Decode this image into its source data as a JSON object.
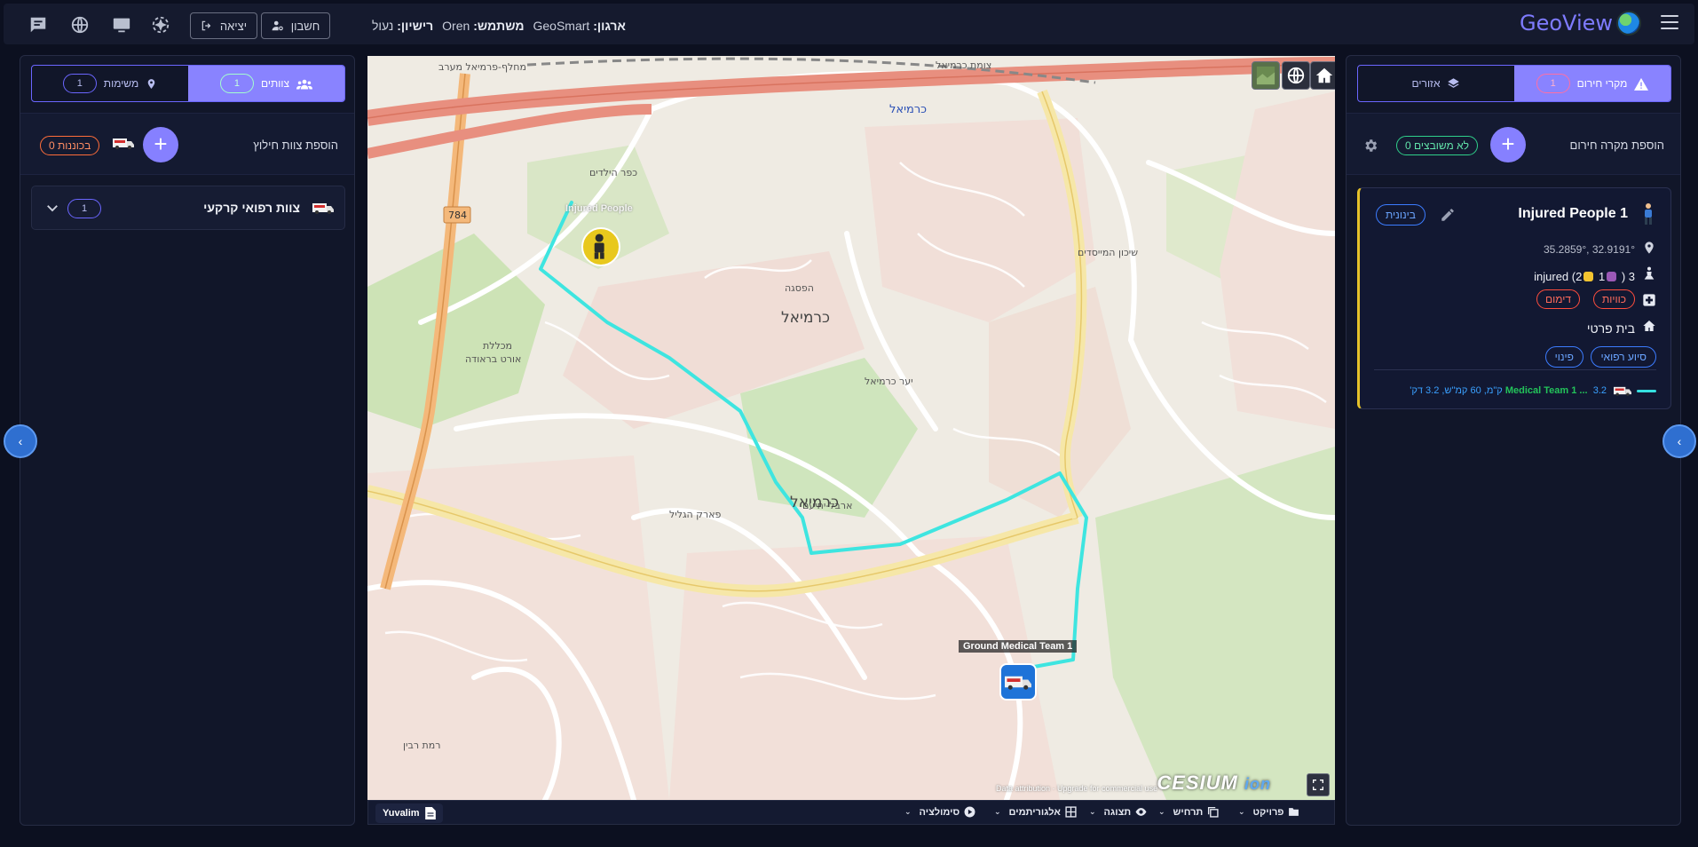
{
  "topbar": {
    "brand": "GeoView",
    "org_label": "ארגון:",
    "org_value": "GeoSmart",
    "user_label": "משתמש:",
    "user_value": "Oren",
    "license_label": "רישיון:",
    "license_value": "נעול",
    "account_button": "חשבון",
    "logout_button": "יציאה"
  },
  "left_panel": {
    "tab_teams": {
      "label": "צוותים",
      "count": "1"
    },
    "tab_missions": {
      "label": "משימות",
      "count": "1"
    },
    "add_team_label": "הוספת צוות חילוץ",
    "ready_pill": "0 בכוננות",
    "group": {
      "label": "צוות רפואי קרקעי",
      "count": "1"
    }
  },
  "right_panel": {
    "tab_incidents": {
      "label": "מקרי חירום",
      "count": "1"
    },
    "tab_areas": {
      "label": "אזורים"
    },
    "add_incident_label": "הוספת מקרה חירום",
    "unassigned_pill": "0 לא משובצים",
    "incident": {
      "title": "Injured People 1",
      "priority": "בינונית",
      "coords": "35.2859°, 32.9191°",
      "injured_total": "3",
      "injured_a": "1",
      "injured_b": "2",
      "injured_word": "injured",
      "tag_burns": "כוויות",
      "tag_bleeding": "דימום",
      "location": "בית פרטי",
      "need_medical": "סיוע רפואי",
      "need_evac": "פינוי",
      "route_team": "Medical Team 1 ...",
      "route_info": "3.2 ק\"מ, 60 קמ\"ש, 3.2 דק'"
    }
  },
  "map": {
    "person_label": "Injured People",
    "team_label": "Ground Medical Team 1",
    "credit": "Data attribution · Upgrade for commercial use",
    "cesium": "CESIUM",
    "cesium_ion": "ion",
    "city_names": [
      "כרמיאל",
      "כרמיאל",
      "כרמיאל"
    ]
  },
  "bottom_bar": {
    "project": "פרויקט",
    "scenario": "תרחיש",
    "display": "תצוגה",
    "algorithms": "אלגוריתמים",
    "simulation": "סימולציה",
    "user": "Yuvalim"
  },
  "colors": {
    "accent": "#8983ff",
    "route": "#35e0e0",
    "incident_border": "#e6c229",
    "background": "#0c1020"
  }
}
